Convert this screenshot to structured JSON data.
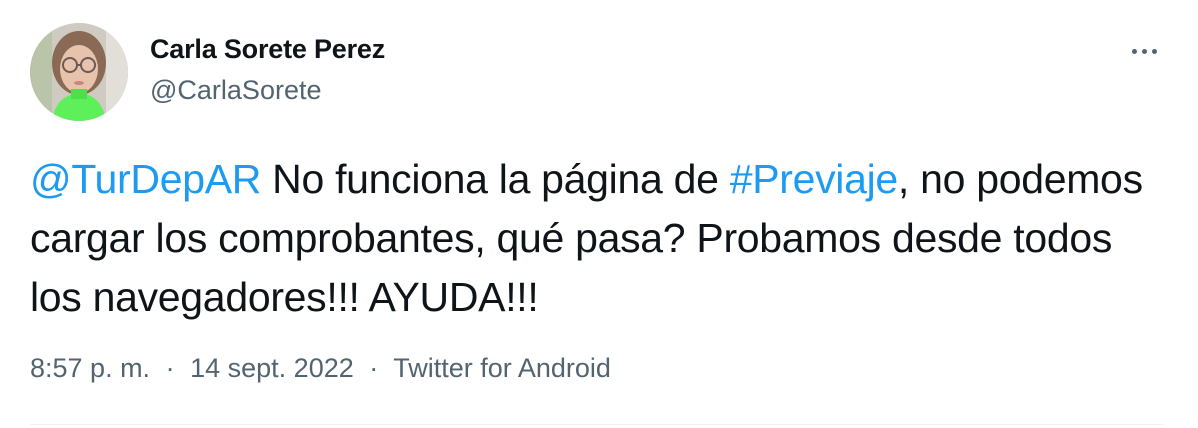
{
  "author": {
    "name": "Carla Sorete Perez",
    "handle": "@CarlaSorete"
  },
  "tweet": {
    "mention": "@TurDepAR",
    "text_1": " No funciona la página de ",
    "hashtag": "#Previaje",
    "text_2": ", no podemos cargar los comprobantes, qué pasa? Probamos desde todos los navegadores!!! AYUDA!!!"
  },
  "meta": {
    "time": "8:57 p. m.",
    "separator": "·",
    "date": "14 sept. 2022",
    "source": "Twitter for Android"
  },
  "icons": {
    "more": "more-horizontal-icon",
    "avatar": "profile-photo"
  },
  "colors": {
    "link": "#1d9bf0",
    "text": "#0f1419",
    "secondary": "#536471"
  }
}
